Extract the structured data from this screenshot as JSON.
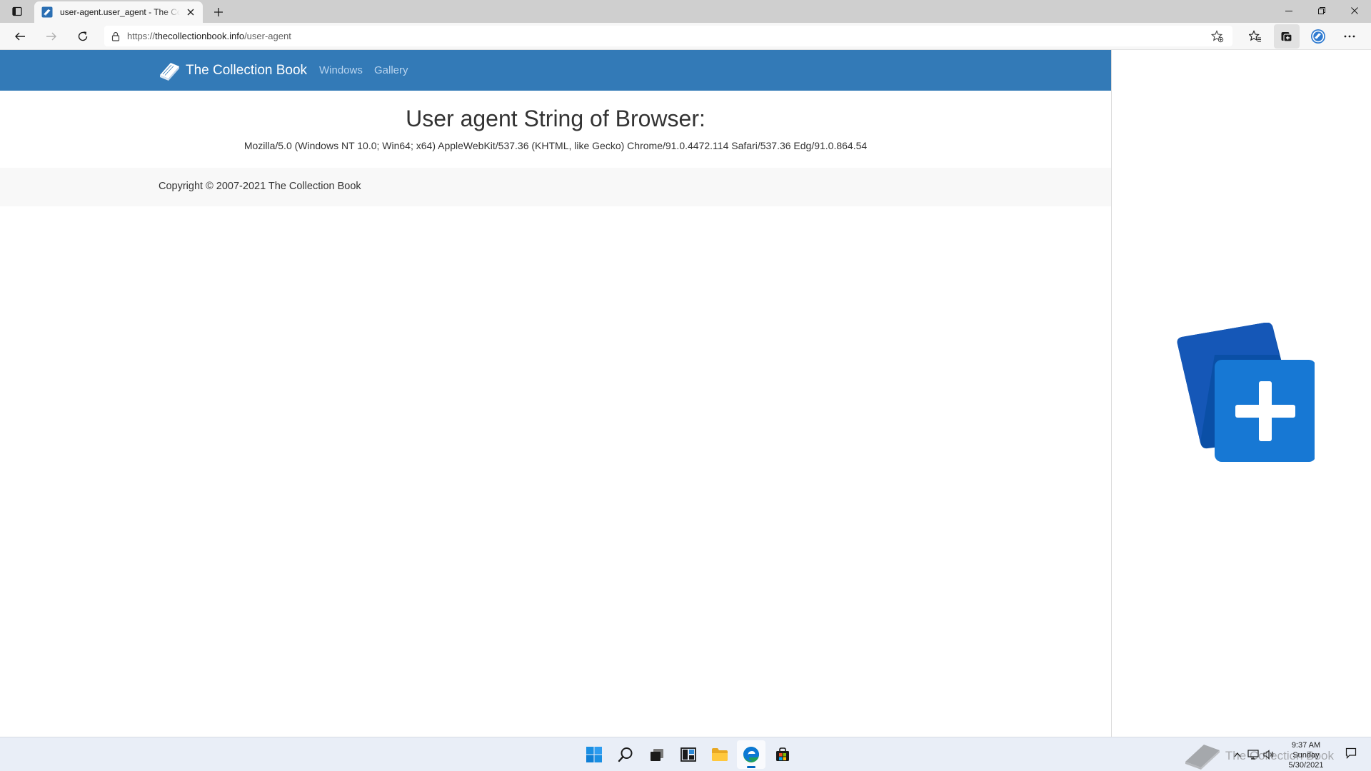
{
  "browser": {
    "tab": {
      "title": "user-agent.user_agent - The Collection Book"
    },
    "address": {
      "scheme": "https://",
      "host": "thecollectionbook.info",
      "path": "/user-agent"
    }
  },
  "page": {
    "navbar": {
      "brand": "The Collection Book",
      "links": [
        "Windows",
        "Gallery"
      ]
    },
    "heading": "User agent String of Browser:",
    "user_agent": "Mozilla/5.0 (Windows NT 10.0; Win64; x64) AppleWebKit/537.36 (KHTML, like Gecko) Chrome/91.0.4472.114 Safari/537.36 Edg/91.0.864.54",
    "footer": {
      "copyright": "Copyright © 2007-2021 The Collection Book"
    },
    "colors": {
      "navbar": "#337ab7",
      "nav_link": "#b7d3ee",
      "accent": "#0067c0"
    }
  },
  "taskbar": {
    "apps": [
      "start-icon",
      "search-icon",
      "task-view-icon",
      "widgets-icon",
      "file-explorer-icon",
      "edge-icon",
      "store-icon"
    ],
    "watermark": "The Collection Book",
    "clock": {
      "time": "9:37 AM",
      "day": "Sunday",
      "date": "5/30/2021"
    }
  }
}
